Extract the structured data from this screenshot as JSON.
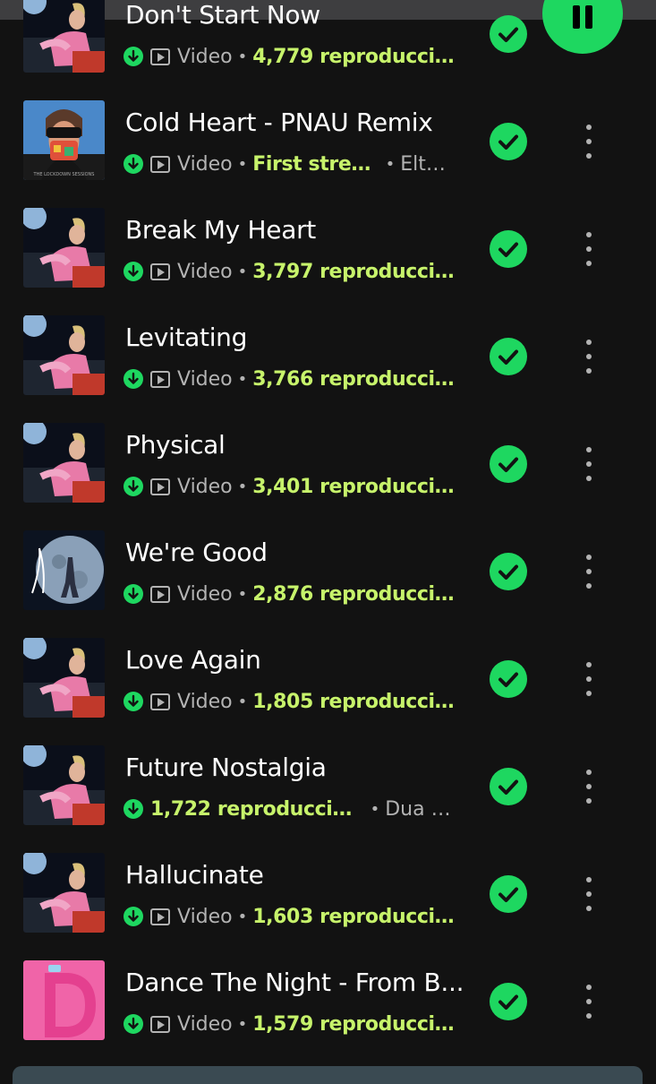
{
  "tracks": [
    {
      "title": "Don't Start Now",
      "video": "Video",
      "plays": "4,779 reproduccio...",
      "artist": "",
      "cover": "future-nostalgia"
    },
    {
      "title": "Cold Heart - PNAU Remix",
      "video": "Video",
      "plays": "First stream",
      "artist": "Elto...",
      "cover": "lockdown-sessions"
    },
    {
      "title": "Break My Heart",
      "video": "Video",
      "plays": "3,797 reproduccio...",
      "artist": "",
      "cover": "future-nostalgia"
    },
    {
      "title": "Levitating",
      "video": "Video",
      "plays": "3,766 reproduccio...",
      "artist": "",
      "cover": "future-nostalgia"
    },
    {
      "title": "Physical",
      "video": "Video",
      "plays": "3,401 reproduccio...",
      "artist": "",
      "cover": "future-nostalgia"
    },
    {
      "title": "We're Good",
      "video": "Video",
      "plays": "2,876 reproducci...",
      "artist": "",
      "cover": "moonlight-edition"
    },
    {
      "title": "Love Again",
      "video": "Video",
      "plays": "1,805 reproduccio...",
      "artist": "",
      "cover": "future-nostalgia"
    },
    {
      "title": "Future Nostalgia",
      "video": "",
      "plays": "1,722 reproducciones",
      "artist": "Dua L...",
      "cover": "future-nostalgia"
    },
    {
      "title": "Hallucinate",
      "video": "Video",
      "plays": "1,603 reproduccio...",
      "artist": "",
      "cover": "future-nostalgia"
    },
    {
      "title": "Dance The Night - From B...",
      "video": "Video",
      "plays": "1,579 reproduccio...",
      "artist": "",
      "cover": "barbie-album"
    }
  ],
  "colors": {
    "background": "#121212",
    "accent_green": "#1ed760",
    "plays_green": "#c7f36b",
    "secondary_text": "#b3b3b3"
  },
  "icons": [
    "download-icon",
    "video-icon",
    "check-icon",
    "more-options-icon",
    "pause-icon"
  ]
}
